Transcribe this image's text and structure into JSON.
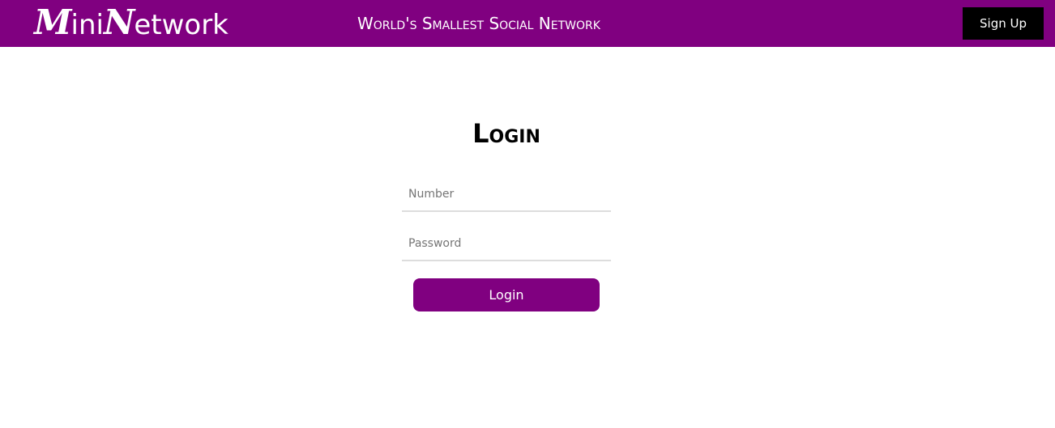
{
  "header": {
    "logo": {
      "cap1": "M",
      "rest1": "ini",
      "cap2": "N",
      "rest2": "etwork"
    },
    "tagline": "World's Smallest Social Network",
    "signup_label": "Sign Up"
  },
  "login": {
    "title": "Login",
    "number_placeholder": "Number",
    "password_placeholder": "Password",
    "submit_label": "Login"
  },
  "colors": {
    "brand": "#800080",
    "signup_bg": "#000000",
    "page_bg": "#ffffff"
  }
}
